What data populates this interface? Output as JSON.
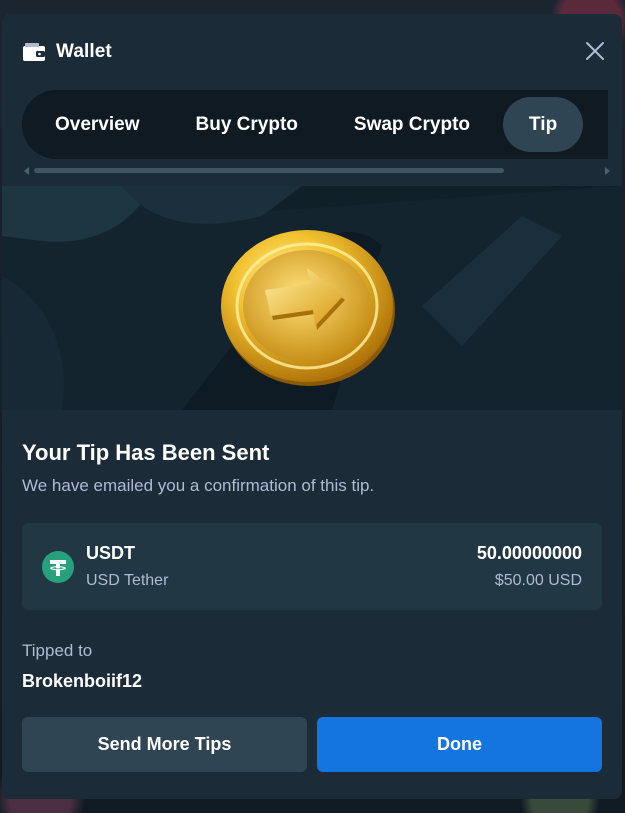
{
  "header": {
    "title": "Wallet",
    "icon": "wallet-icon"
  },
  "tabs": [
    {
      "label": "Overview",
      "active": false
    },
    {
      "label": "Buy Crypto",
      "active": false
    },
    {
      "label": "Swap Crypto",
      "active": false
    },
    {
      "label": "Tip",
      "active": true
    }
  ],
  "confirmation": {
    "heading": "Your Tip Has Been Sent",
    "subtext": "We have emailed you a confirmation of this tip."
  },
  "currency": {
    "symbol": "USDT",
    "name": "USD Tether",
    "amount": "50.00000000",
    "usd_value": "$50.00 USD",
    "icon": "tether-icon",
    "color": "#26a17b"
  },
  "recipient": {
    "label": "Tipped to",
    "username": "Brokenboiif12"
  },
  "buttons": {
    "secondary": "Send More Tips",
    "primary": "Done"
  },
  "colors": {
    "modal_bg": "#1b2c38",
    "card_bg": "#213743",
    "accent": "#1475e1",
    "muted_text": "#b1bad3"
  }
}
